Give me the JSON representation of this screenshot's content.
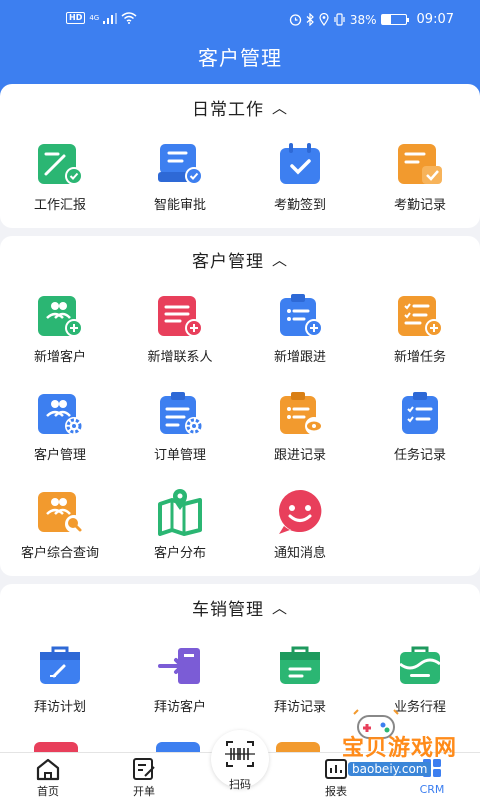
{
  "status_bar": {
    "hd_badge": "HD",
    "network": "4G",
    "battery_text": "38%",
    "battery_level": 0.38,
    "time": "09:07"
  },
  "header": {
    "title": "客户管理"
  },
  "sections": {
    "daily": {
      "title": "日常工作",
      "expand_icon": "chevron-up-icon",
      "items": [
        {
          "label": "工作汇报",
          "icon": "work-report-icon",
          "color": "#2bb673"
        },
        {
          "label": "智能审批",
          "icon": "approval-icon",
          "color": "#3d7ff0"
        },
        {
          "label": "考勤签到",
          "icon": "attendance-checkin-icon",
          "color": "#3d7ff0"
        },
        {
          "label": "考勤记录",
          "icon": "attendance-record-icon",
          "color": "#f29a2e"
        }
      ]
    },
    "customer": {
      "title": "客户管理",
      "expand_icon": "chevron-up-icon",
      "items": [
        {
          "label": "新增客户",
          "icon": "add-customer-icon",
          "color": "#2bb673"
        },
        {
          "label": "新增联系人",
          "icon": "add-contact-icon",
          "color": "#e83f5b"
        },
        {
          "label": "新增跟进",
          "icon": "add-followup-icon",
          "color": "#3d7ff0"
        },
        {
          "label": "新增任务",
          "icon": "add-task-icon",
          "color": "#f29a2e"
        },
        {
          "label": "客户管理",
          "icon": "customer-manage-icon",
          "color": "#3d7ff0"
        },
        {
          "label": "订单管理",
          "icon": "order-manage-icon",
          "color": "#3d7ff0"
        },
        {
          "label": "跟进记录",
          "icon": "followup-record-icon",
          "color": "#f29a2e"
        },
        {
          "label": "任务记录",
          "icon": "task-record-icon",
          "color": "#3d7ff0"
        },
        {
          "label": "客户综合查询",
          "icon": "customer-query-icon",
          "color": "#f29a2e"
        },
        {
          "label": "客户分布",
          "icon": "customer-map-icon",
          "color": "#2bb673"
        },
        {
          "label": "通知消息",
          "icon": "notification-smile-icon",
          "color": "#e83f5b"
        }
      ]
    },
    "sales": {
      "title": "车销管理",
      "expand_icon": "chevron-up-icon",
      "items": [
        {
          "label": "拜访计划",
          "icon": "visit-plan-icon",
          "color": "#3d7ff0"
        },
        {
          "label": "拜访客户",
          "icon": "visit-customer-icon",
          "color": "#7b5cd6"
        },
        {
          "label": "拜访记录",
          "icon": "visit-record-icon",
          "color": "#2bb673"
        },
        {
          "label": "业务行程",
          "icon": "business-trip-icon",
          "color": "#2bb673"
        }
      ]
    }
  },
  "tabbar": {
    "home": "首页",
    "order": "开单",
    "scan": "扫码",
    "report": "报表",
    "crm": "CRM"
  },
  "watermark": {
    "text": "宝贝游戏网",
    "url": "baobeiy.com"
  },
  "colors": {
    "primary": "#3d7ff0",
    "background": "#f1f2f6",
    "watermark": "#ff8b1a"
  }
}
